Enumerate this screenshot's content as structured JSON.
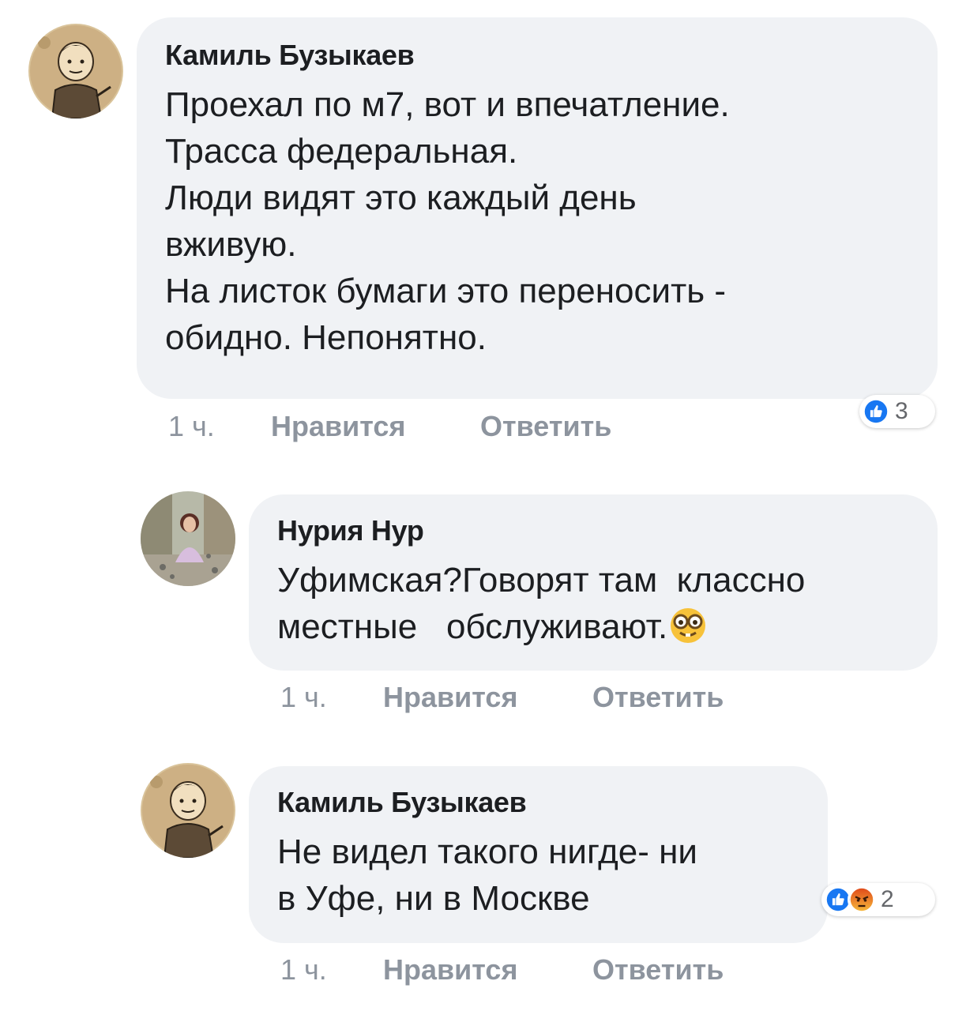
{
  "comments": [
    {
      "author": "Камиль Бузыкаев",
      "lines": [
        "Проехал по м7, вот и впечатление.",
        "Трасса федеральная.",
        "Люди видят это каждый день",
        "вживую.",
        "На листок бумаги это переносить -",
        "обидно. Непонятно."
      ],
      "time": "1 ч.",
      "like_label": "Нравится",
      "reply_label": "Ответить",
      "reactions": {
        "icons": [
          "like-icon"
        ],
        "count": "3"
      }
    },
    {
      "author": "Нурия Нур",
      "lines": [
        "Уфимская?Говорят там  классно",
        "местные   обслуживают."
      ],
      "emoji": "nerd-face-emoji-icon",
      "time": "1 ч.",
      "like_label": "Нравится",
      "reply_label": "Ответить"
    },
    {
      "author": "Камиль Бузыкаев",
      "lines": [
        "Не видел такого нигде- ни",
        "в Уфе, ни в Москве"
      ],
      "time": "1 ч.",
      "like_label": "Нравится",
      "reply_label": "Ответить",
      "reactions": {
        "icons": [
          "like-icon",
          "angry-icon"
        ],
        "count": "2"
      }
    }
  ],
  "colors": {
    "bubble": "#f0f2f5",
    "meta_text": "#8d949e",
    "like_blue": "#1877f2",
    "angry_orange": "#e9710f"
  }
}
